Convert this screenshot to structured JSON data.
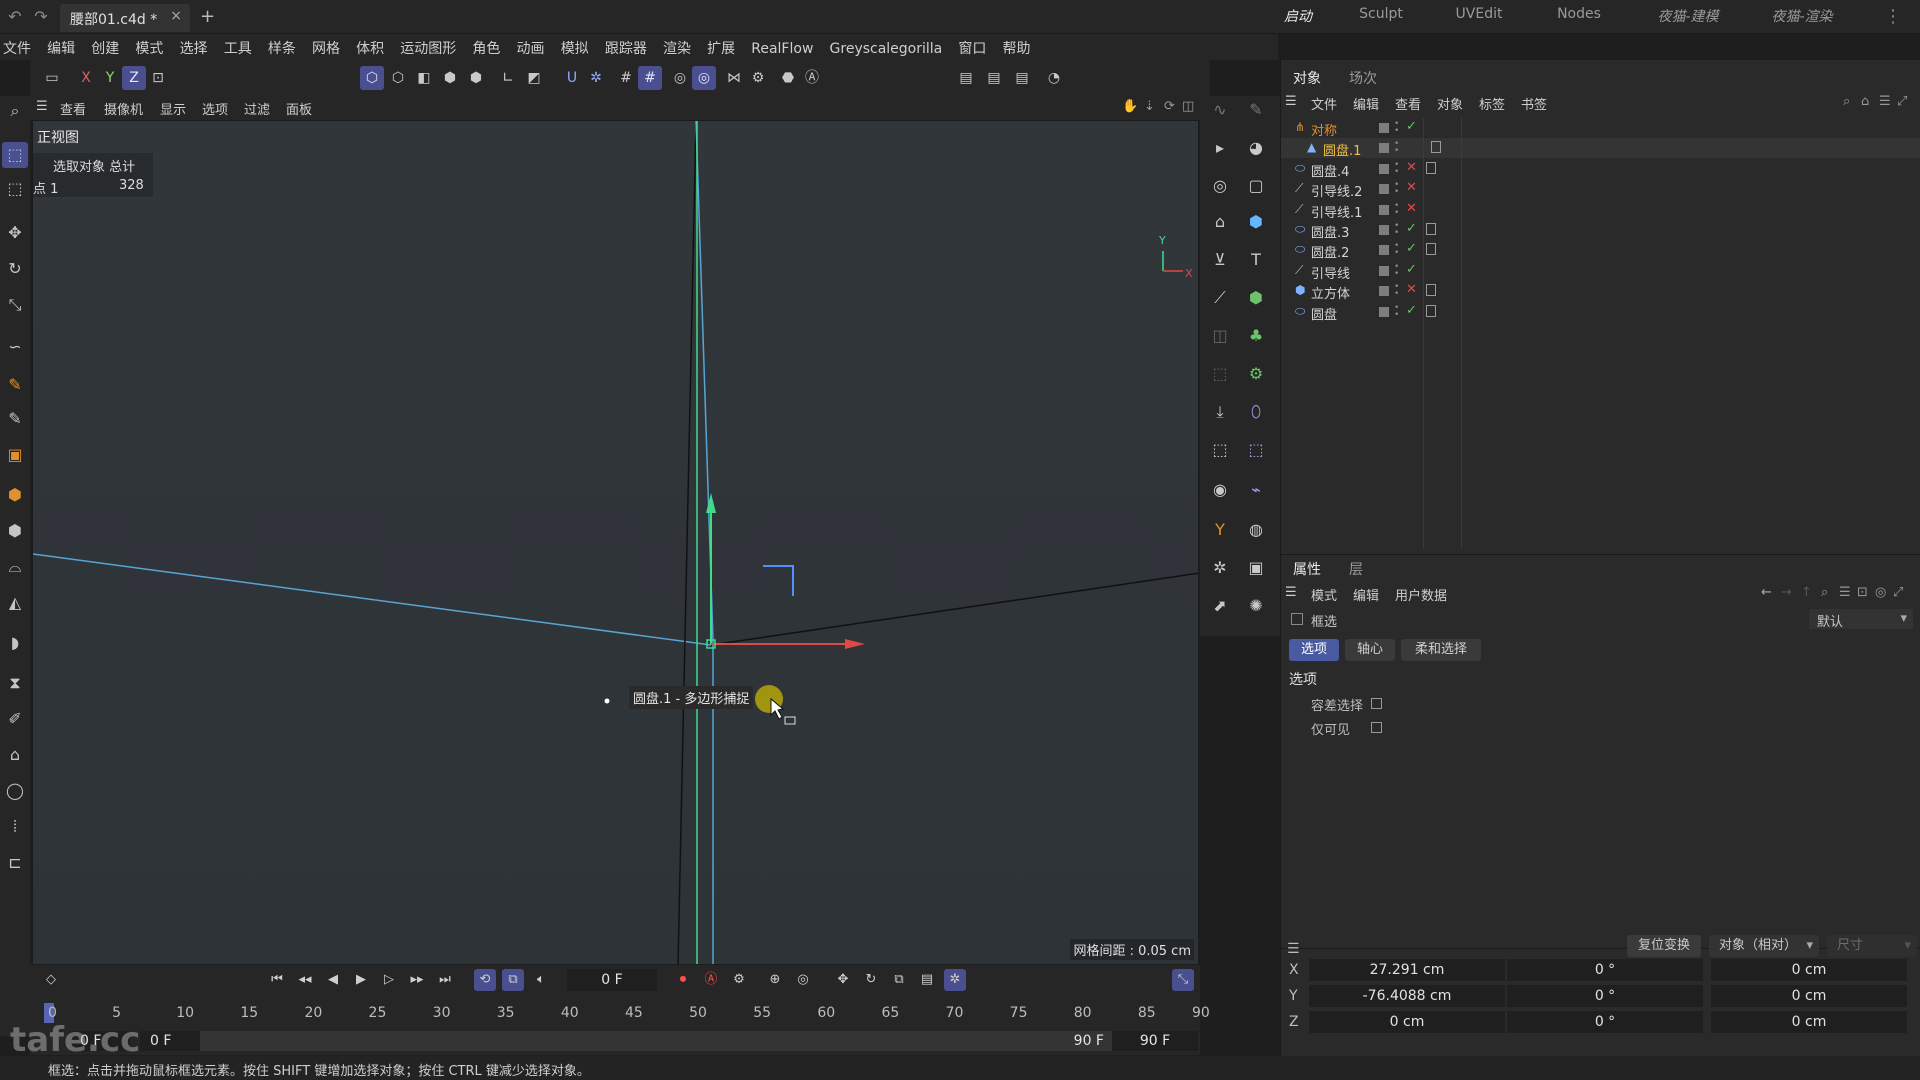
{
  "title_bar": {
    "document_tab": "腰部01.c4d *",
    "close_glyph": "×",
    "new_tab_glyph": "+",
    "layouts": [
      "启动",
      "Sculpt",
      "UVEdit",
      "Nodes",
      "夜猫-建模",
      "夜猫-渲染"
    ],
    "active_layout": "启动"
  },
  "menu": [
    "文件",
    "编辑",
    "创建",
    "模式",
    "选择",
    "工具",
    "样条",
    "网格",
    "体积",
    "运动图形",
    "角色",
    "动画",
    "模拟",
    "跟踪器",
    "渲染",
    "扩展",
    "RealFlow",
    "Greyscalegorilla",
    "窗口",
    "帮助"
  ],
  "toolbar": {
    "axis_x": "X",
    "axis_y": "Y",
    "axis_z": "Z"
  },
  "viewport": {
    "menu": [
      "查看",
      "摄像机",
      "显示",
      "选项",
      "过滤",
      "面板"
    ],
    "view_name": "正视图",
    "info_header": "选取对象 总计",
    "info_row_label": "点 1",
    "info_row_value": "328",
    "grid_spacing": "网格间距 : 0.05 cm",
    "snap_tooltip": "圆盘.1 - 多边形捕捉",
    "axis_y_label": "Y",
    "axis_x_label": "X"
  },
  "object_manager": {
    "tabs": [
      "对象",
      "场次"
    ],
    "menu": [
      "文件",
      "编辑",
      "查看",
      "对象",
      "标签",
      "书签"
    ],
    "objects": [
      {
        "name": "对称",
        "icon": "symmetry-icon",
        "state": "on",
        "level": 0,
        "color": "#e0912f",
        "tag": false
      },
      {
        "name": "圆盘.1",
        "icon": "editable-poly-icon",
        "state": "none",
        "level": 1,
        "color": "#f0c040",
        "tag": true
      },
      {
        "name": "圆盘.4",
        "icon": "disc-icon",
        "state": "off",
        "level": 0,
        "color": "#d4d4d4",
        "tag": true
      },
      {
        "name": "引导线.2",
        "icon": "guide-icon",
        "state": "off",
        "level": 0,
        "color": "#d4d4d4",
        "tag": false
      },
      {
        "name": "引导线.1",
        "icon": "guide-icon",
        "state": "off",
        "level": 0,
        "color": "#d4d4d4",
        "tag": false
      },
      {
        "name": "圆盘.3",
        "icon": "disc-icon",
        "state": "on",
        "level": 0,
        "color": "#d4d4d4",
        "tag": true
      },
      {
        "name": "圆盘.2",
        "icon": "disc-icon",
        "state": "on",
        "level": 0,
        "color": "#d4d4d4",
        "tag": true
      },
      {
        "name": "引导线",
        "icon": "guide-icon",
        "state": "on",
        "level": 0,
        "color": "#d4d4d4",
        "tag": false
      },
      {
        "name": "立方体",
        "icon": "cube-icon",
        "state": "off",
        "level": 0,
        "color": "#d4d4d4",
        "tag": true
      },
      {
        "name": "圆盘",
        "icon": "disc-icon",
        "state": "on",
        "level": 0,
        "color": "#d4d4d4",
        "tag": true
      }
    ]
  },
  "attributes": {
    "tabs": [
      "属性",
      "层"
    ],
    "menu": [
      "模式",
      "编辑",
      "用户数据"
    ],
    "tool_name": "框选",
    "preset": "默认",
    "pills": [
      "选项",
      "轴心",
      "柔和选择"
    ],
    "section": "选项",
    "options": [
      "容差选择",
      "仅可见"
    ]
  },
  "coordinates": {
    "reset_button": "复位变换",
    "mode_dropdown": "对象（相对）",
    "size_label": "尺寸",
    "rows": [
      {
        "axis": "X",
        "pos": "27.291 cm",
        "rot": "0 °",
        "size": "0 cm"
      },
      {
        "axis": "Y",
        "pos": "-76.4088 cm",
        "rot": "0 °",
        "size": "0 cm"
      },
      {
        "axis": "Z",
        "pos": "0 cm",
        "rot": "0 °",
        "size": "0 cm"
      }
    ]
  },
  "timeline": {
    "current_frame": "0 F",
    "ruler": [
      "0",
      "5",
      "10",
      "15",
      "20",
      "25",
      "30",
      "35",
      "40",
      "45",
      "50",
      "55",
      "60",
      "65",
      "70",
      "75",
      "80",
      "85",
      "90"
    ],
    "start_a": "0 F",
    "start_b": "0 F",
    "end_a": "90 F",
    "end_b": "90 F"
  },
  "status": "框选：点击并拖动鼠标框选元素。按住 SHIFT 键增加选择对象；按住 CTRL 键减少选择对象。",
  "watermark": "tafe.cc"
}
